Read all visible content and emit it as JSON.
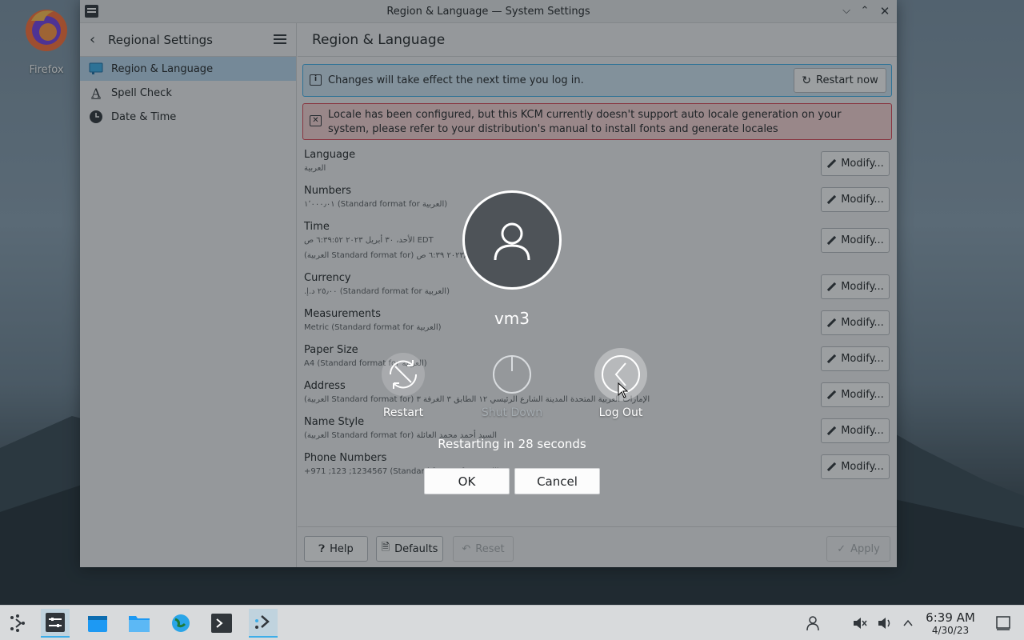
{
  "desktop": {
    "firefox_label": "Firefox"
  },
  "window": {
    "title": "Region & Language — System Settings"
  },
  "sidebar": {
    "title": "Regional Settings",
    "items": [
      {
        "label": "Region & Language",
        "icon": "region-icon",
        "active": true
      },
      {
        "label": "Spell Check",
        "icon": "spellcheck-icon",
        "active": false
      },
      {
        "label": "Date & Time",
        "icon": "clock-icon",
        "active": false
      }
    ]
  },
  "content": {
    "title": "Region & Language",
    "info_message": "Changes will take effect the next time you log in.",
    "restart_now_label": "Restart now",
    "error_message": "Locale has been configured, but this KCM currently doesn't support auto locale generation on your system, please refer to your distribution's manual to install fonts and generate locales",
    "modify_label": "Modify...",
    "rows": [
      {
        "title": "Language",
        "sub": "العربية",
        "sub2": ""
      },
      {
        "title": "Numbers",
        "sub": "١٬٠٠٠٫٠١ (Standard format for العربية)",
        "sub2": ""
      },
      {
        "title": "Time",
        "sub": "الأحد، ٣٠ أبريل ٢٠٢٣ ٦:٣٩:٥٢ ص EDT",
        "sub2": "(العربية Standard format for) ٢٠٢٣/٤/٣٠ ٦:٣٩ ص"
      },
      {
        "title": "Currency",
        "sub": "٢٥٫٠٠ د.إ.‏ (Standard format for العربية)",
        "sub2": ""
      },
      {
        "title": "Measurements",
        "sub": "Metric (Standard format for العربية)",
        "sub2": ""
      },
      {
        "title": "Paper Size",
        "sub": "A4 (Standard format for العربية)",
        "sub2": ""
      },
      {
        "title": "Address",
        "sub": "(العربية Standard format for) الإمارات العربية المتحدة المدينة الشارع الرئيسي ١٢ الطابق ٣ الغرفة ٣",
        "sub2": ""
      },
      {
        "title": "Name Style",
        "sub": "(العربية Standard format for) السيد أحمد محمد العائلة",
        "sub2": ""
      },
      {
        "title": "Phone Numbers",
        "sub": "+971 ;123 ;1234567 (Standard format for العربية)",
        "sub2": ""
      }
    ],
    "footer": {
      "help": "Help",
      "defaults": "Defaults",
      "reset": "Reset",
      "apply": "Apply"
    }
  },
  "logout": {
    "username": "vm3",
    "actions": {
      "restart": "Restart",
      "shutdown": "Shut Down",
      "logout": "Log Out"
    },
    "countdown": "Restarting in 28 seconds",
    "ok": "OK",
    "cancel": "Cancel"
  },
  "taskbar": {
    "time": "6:39 AM",
    "date": "4/30/23"
  }
}
